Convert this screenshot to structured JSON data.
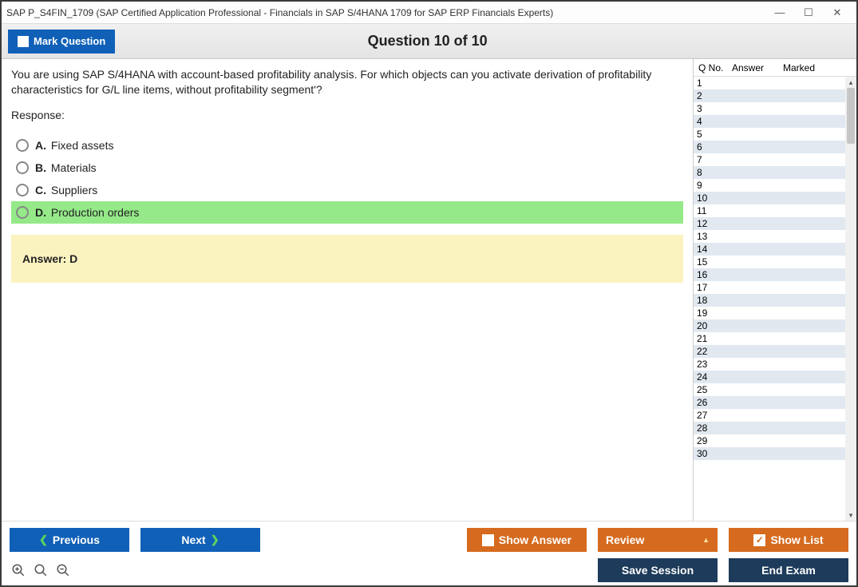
{
  "window": {
    "title": "SAP P_S4FIN_1709 (SAP Certified Application Professional - Financials in SAP S/4HANA 1709 for SAP ERP Financials Experts)"
  },
  "header": {
    "mark_label": "Mark Question",
    "title": "Question 10 of 10"
  },
  "question": {
    "text": "You are using SAP S/4HANA with account-based profitability analysis. For which objects can you activate derivation of profitability characteristics for G/L line items, without profitability segment'?",
    "response_label": "Response:",
    "options": [
      {
        "letter": "A.",
        "text": "Fixed assets",
        "correct": false
      },
      {
        "letter": "B.",
        "text": "Materials",
        "correct": false
      },
      {
        "letter": "C.",
        "text": "Suppliers",
        "correct": false
      },
      {
        "letter": "D.",
        "text": "Production orders",
        "correct": true
      }
    ],
    "answer_label": "Answer: D"
  },
  "side": {
    "headers": {
      "qno": "Q No.",
      "answer": "Answer",
      "marked": "Marked"
    },
    "rows": [
      "1",
      "2",
      "3",
      "4",
      "5",
      "6",
      "7",
      "8",
      "9",
      "10",
      "11",
      "12",
      "13",
      "14",
      "15",
      "16",
      "17",
      "18",
      "19",
      "20",
      "21",
      "22",
      "23",
      "24",
      "25",
      "26",
      "27",
      "28",
      "29",
      "30"
    ]
  },
  "buttons": {
    "previous": "Previous",
    "next": "Next",
    "show_answer": "Show Answer",
    "review": "Review",
    "show_list": "Show List",
    "save_session": "Save Session",
    "end_exam": "End Exam"
  }
}
